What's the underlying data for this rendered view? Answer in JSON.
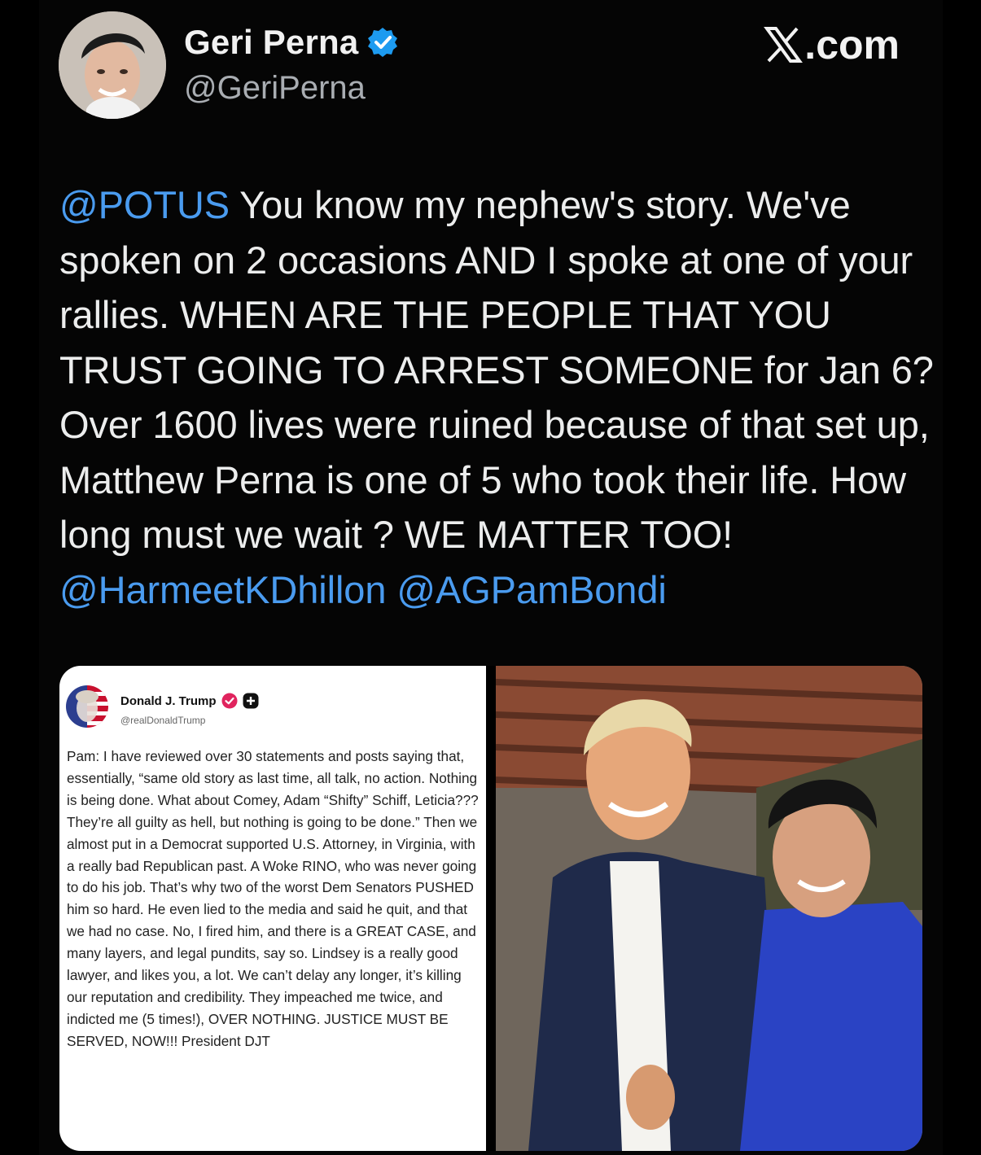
{
  "header": {
    "display_name": "Geri Perna",
    "handle": "@GeriPerna",
    "site_label": ".com",
    "verified_color": "#1d9bf0"
  },
  "tweet": {
    "segments": [
      {
        "text": "@POTUS",
        "mention": true
      },
      {
        "text": " You know my nephew's story. We've spoken on 2 occasions AND I spoke at one of your rallies. WHEN ARE THE PEOPLE THAT YOU TRUST GOING TO ARREST SOMEONE for Jan 6? Over 1600 lives were ruined because of that set up, Matthew Perna is one of 5 who took their life. How long must we wait ? WE MATTER TOO! ",
        "mention": false
      },
      {
        "text": "@HarmeetKDhillon",
        "mention": true
      },
      {
        "text": " ",
        "mention": false
      },
      {
        "text": "@AGPamBondi",
        "mention": true
      }
    ],
    "mention_color": "#4a9bef"
  },
  "embedded_post": {
    "author": "Donald J. Trump",
    "handle": "@realDonaldTrump",
    "body": "Pam: I have reviewed over 30 statements and posts saying that, essentially, “same old story as last time, all talk, no action. Nothing is being done. What about Comey, Adam “Shifty” Schiff, Leticia??? They’re all guilty as hell, but nothing is going to be done.” Then we almost put in a Democrat supported U.S. Attorney, in Virginia, with a really bad Republican past. A Woke RINO, who was never going to do his job. That’s why two of the worst Dem Senators PUSHED him so hard. He even lied to the media and said he quit, and that we had no case. No, I fired him, and there is a GREAT CASE, and many layers, and legal pundits, say so. Lindsey is a really good lawyer, and likes you, a lot. We can’t delay any longer, it’s killing our reputation and credibility. They impeached me twice, and indicted me (5 times!), OVER NOTHING. JUSTICE MUST BE SERVED, NOW!!! President DJT",
    "badge_color": "#e0245e"
  }
}
